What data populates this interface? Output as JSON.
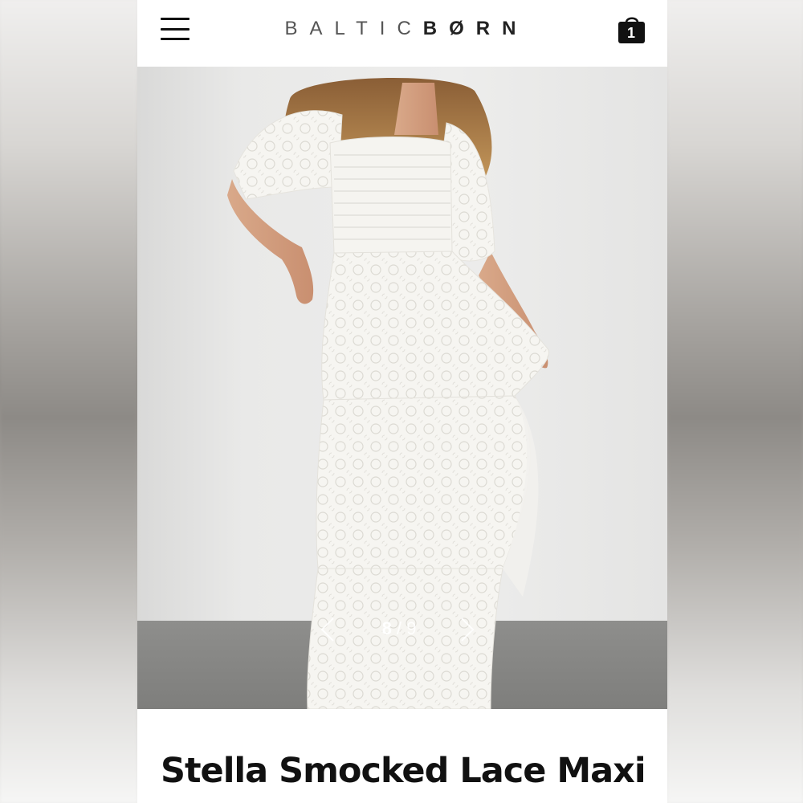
{
  "header": {
    "logo_light": "BALTIC",
    "logo_dark": "BØRN",
    "cart_count": "1"
  },
  "carousel": {
    "current": "8",
    "separator": "/",
    "total": "9"
  },
  "product": {
    "title": "Stella Smocked Lace Maxi"
  },
  "icons": {
    "menu": "hamburger-menu-icon",
    "cart": "shopping-bag-icon",
    "prev": "chevron-left-icon",
    "next": "chevron-right-icon"
  },
  "colors": {
    "brand_text": "#555555",
    "background": "#ffffff",
    "dress": "#f7f6f3"
  }
}
